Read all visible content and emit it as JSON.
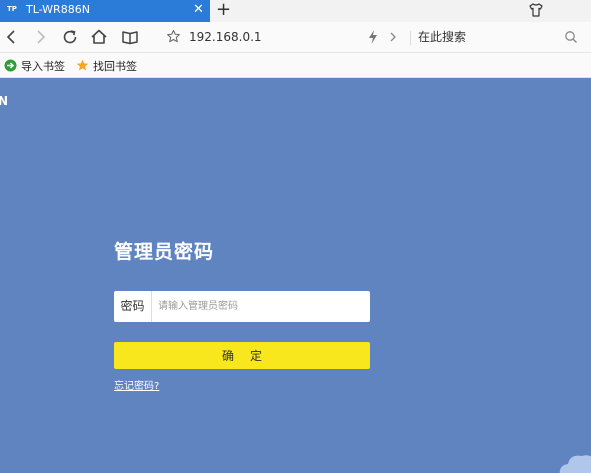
{
  "browser": {
    "tab": {
      "favicon_text": "TP",
      "title": "TL-WR886N"
    },
    "address_bar": {
      "url": "192.168.0.1"
    },
    "search": {
      "placeholder": "在此搜索"
    },
    "bookmarks": [
      {
        "label": "导入书签",
        "icon": "import-bookmark-icon"
      },
      {
        "label": "找回书签",
        "icon": "star-icon"
      }
    ]
  },
  "page": {
    "edge_text": "N",
    "login": {
      "title": "管理员密码",
      "password_label": "密码",
      "password_placeholder": "请输入管理员密码",
      "confirm_label": "确定",
      "forgot_link": "忘记密码?"
    }
  },
  "colors": {
    "tab_active": "#2b7cd9",
    "page_background": "#6084c0",
    "confirm_button": "#f8e71c"
  }
}
